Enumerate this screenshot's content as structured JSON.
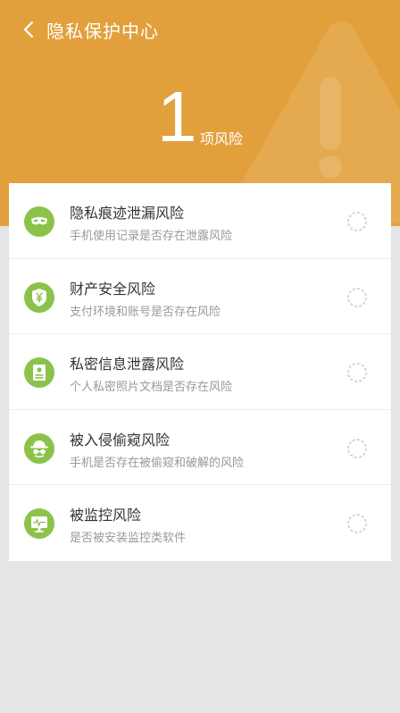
{
  "header": {
    "title": "隐私保护中心",
    "risk_count": "1",
    "risk_unit": "项风险",
    "background_color": "#e2a03c",
    "back_icon": "chevron-left-icon",
    "decoration_icon": "warning-triangle-icon"
  },
  "risks": [
    {
      "title": "隐私痕迹泄漏风险",
      "subtitle": "手机使用记录是否存在泄露风险",
      "icon": "mask-icon",
      "status": "scanning"
    },
    {
      "title": "财产安全风险",
      "subtitle": "支付环境和账号是否存在风险",
      "icon": "yuan-shield-icon",
      "status": "scanning"
    },
    {
      "title": "私密信息泄露风险",
      "subtitle": "个人私密照片文档是否存在风险",
      "icon": "id-card-icon",
      "status": "scanning"
    },
    {
      "title": "被入侵偷窥风险",
      "subtitle": "手机是否存在被偷窥和破解的风险",
      "icon": "spy-icon",
      "status": "scanning"
    },
    {
      "title": "被监控风险",
      "subtitle": "是否被安装监控类软件",
      "icon": "monitor-icon",
      "status": "scanning"
    }
  ],
  "colors": {
    "accent": "#e2a03c",
    "icon_green": "#8bc34a",
    "page_background": "#e5e5e5"
  }
}
